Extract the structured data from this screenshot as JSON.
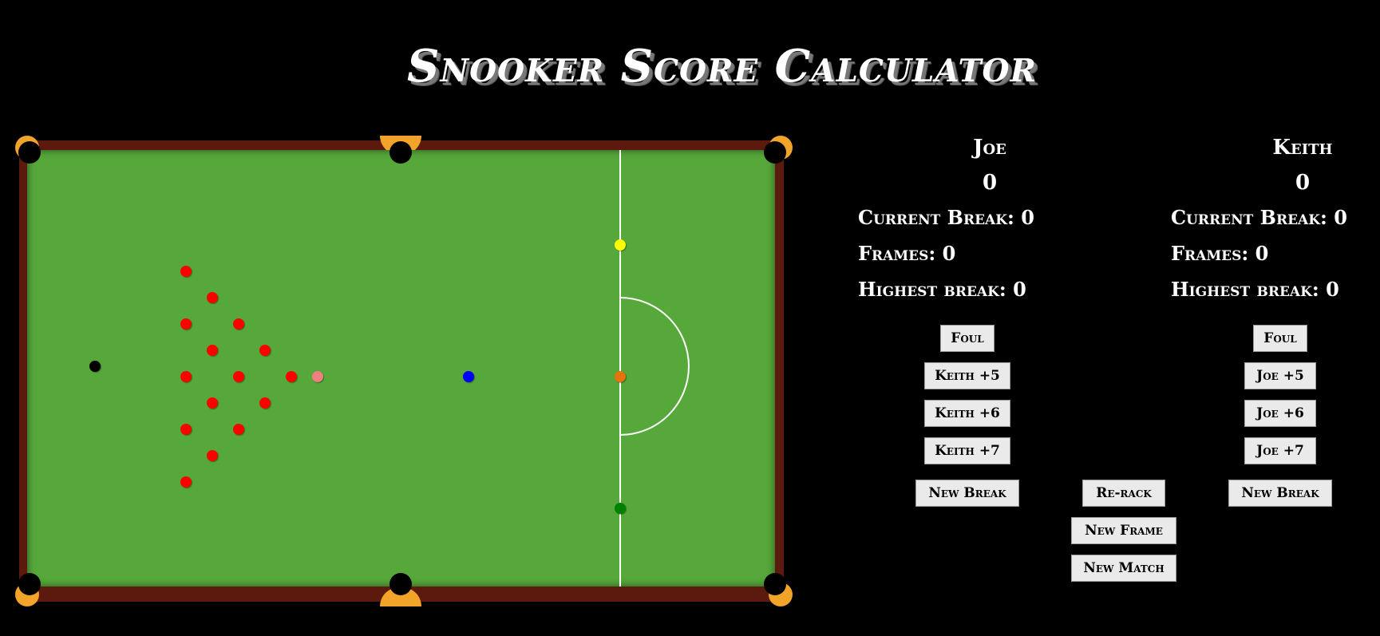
{
  "app": {
    "title": "Snooker Score Calculator"
  },
  "colors": {
    "background": "#000000",
    "felt": "#56a83a",
    "cushion": "#5c1a0e",
    "pocket_rim": "#f2a32a",
    "red": "#ff0000",
    "yellow": "#ffff00",
    "green": "#008000",
    "brown": "#e8720c",
    "blue": "#0000ff",
    "pink": "#f08080",
    "black": "#000000"
  },
  "players": [
    {
      "name": "Joe",
      "score": "0",
      "current_break": "Current Break: 0",
      "frames": "Frames: 0",
      "highest_break": "Highest break: 0",
      "foul_label": "Foul",
      "foul_options": [
        "Keith +5",
        "Keith +6",
        "Keith +7"
      ],
      "new_break_label": "New Break"
    },
    {
      "name": "Keith",
      "score": "0",
      "current_break": "Current Break: 0",
      "frames": "Frames: 0",
      "highest_break": "Highest break: 0",
      "foul_label": "Foul",
      "foul_options": [
        "Joe +5",
        "Joe +6",
        "Joe +7"
      ],
      "new_break_label": "New Break"
    }
  ],
  "controls": {
    "rerack_label": "Re-rack",
    "new_frame_label": "New Frame",
    "new_match_label": "New Match"
  }
}
